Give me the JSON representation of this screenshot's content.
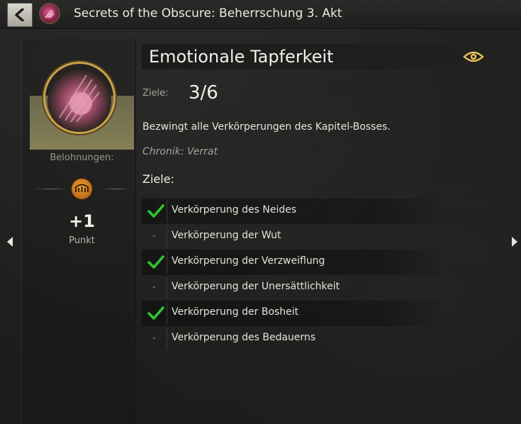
{
  "header": {
    "title": "Secrets of the Obscure: Beherrschung 3. Akt",
    "back_icon": "chevron-left-icon",
    "category_icon": "achievement-category-icon"
  },
  "achievement": {
    "title": "Emotionale Tapferkeit",
    "goal_label": "Ziele:",
    "progress": "3/6",
    "progress_value": 0.5,
    "description": "Bezwingt alle Verkörperungen des Kapitel-Bosses.",
    "category": "Chronik: Verrat",
    "objectives_heading": "Ziele:",
    "objectives": [
      {
        "label": "Verkörperung des Neides",
        "completed": true,
        "marker": "-"
      },
      {
        "label": "Verkörperung der Wut",
        "completed": false,
        "marker": "-"
      },
      {
        "label": "Verkörperung der Verzweiflung",
        "completed": true,
        "marker": "-"
      },
      {
        "label": "Verkörperung der Unersättlichkeit",
        "completed": false,
        "marker": "-"
      },
      {
        "label": "Verkörperung der Bosheit",
        "completed": true,
        "marker": "-"
      },
      {
        "label": "Verkörperung des Bedauerns",
        "completed": false,
        "marker": "-"
      }
    ]
  },
  "rewards": {
    "label": "Belohnungen:",
    "points_value": "+1",
    "points_label": "Punkt",
    "points_icon": "achievement-point-icon"
  },
  "colors": {
    "checkmark": "#2fc72f",
    "coin": "#d98a2a",
    "eye": "#e9c35a"
  }
}
